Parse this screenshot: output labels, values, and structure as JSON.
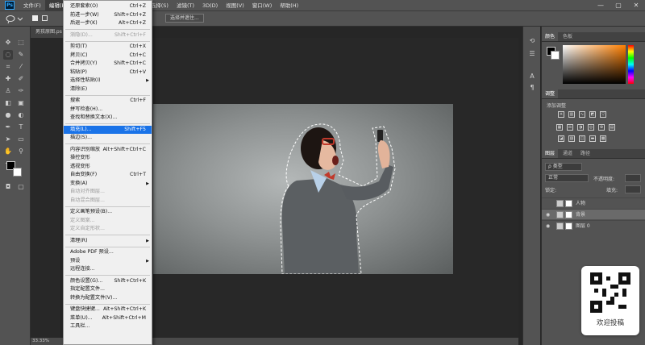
{
  "menubar": {
    "logo": "Ps",
    "items": [
      "文件(F)",
      "编辑(E)",
      "图像(I)",
      "图层(L)",
      "文字(Y)",
      "选择(S)",
      "滤镜(T)",
      "3D(D)",
      "视图(V)",
      "窗口(W)",
      "帮助(H)"
    ],
    "active_index": 1,
    "window_controls": [
      "—",
      "▢",
      "✕"
    ]
  },
  "optionsbar": {
    "select_mask_label": "选择并遮住..."
  },
  "document": {
    "tab_label": "男孩原图.ps",
    "zoom": "33.33%"
  },
  "edit_menu": {
    "items": [
      {
        "label": "还原套索(O)",
        "shortcut": "Ctrl+Z",
        "disabled": false,
        "arrow": false,
        "sep_after": false
      },
      {
        "label": "前进一步(W)",
        "shortcut": "Shift+Ctrl+Z",
        "disabled": false,
        "arrow": false,
        "sep_after": false
      },
      {
        "label": "后退一步(K)",
        "shortcut": "Alt+Ctrl+Z",
        "disabled": false,
        "arrow": false,
        "sep_after": true
      },
      {
        "label": "渐隐(D)...",
        "shortcut": "Shift+Ctrl+F",
        "disabled": true,
        "arrow": false,
        "sep_after": true
      },
      {
        "label": "剪切(T)",
        "shortcut": "Ctrl+X",
        "disabled": false,
        "arrow": false,
        "sep_after": false
      },
      {
        "label": "拷贝(C)",
        "shortcut": "Ctrl+C",
        "disabled": false,
        "arrow": false,
        "sep_after": false
      },
      {
        "label": "合并拷贝(Y)",
        "shortcut": "Shift+Ctrl+C",
        "disabled": false,
        "arrow": false,
        "sep_after": false
      },
      {
        "label": "粘贴(P)",
        "shortcut": "Ctrl+V",
        "disabled": false,
        "arrow": false,
        "sep_after": false
      },
      {
        "label": "选择性粘贴(I)",
        "shortcut": "",
        "disabled": false,
        "arrow": true,
        "sep_after": false
      },
      {
        "label": "清除(E)",
        "shortcut": "",
        "disabled": false,
        "arrow": false,
        "sep_after": true
      },
      {
        "label": "搜索",
        "shortcut": "Ctrl+F",
        "disabled": false,
        "arrow": false,
        "sep_after": false
      },
      {
        "label": "拼写检查(H)...",
        "shortcut": "",
        "disabled": false,
        "arrow": false,
        "sep_after": false
      },
      {
        "label": "查找和替换文本(X)...",
        "shortcut": "",
        "disabled": false,
        "arrow": false,
        "sep_after": true
      },
      {
        "label": "填充(L)...",
        "shortcut": "Shift+F5",
        "disabled": false,
        "arrow": false,
        "sep_after": false,
        "highlight": true
      },
      {
        "label": "描边(S)...",
        "shortcut": "",
        "disabled": false,
        "arrow": false,
        "sep_after": true
      },
      {
        "label": "内容识别缩放",
        "shortcut": "Alt+Shift+Ctrl+C",
        "disabled": false,
        "arrow": false,
        "sep_after": false
      },
      {
        "label": "操控变形",
        "shortcut": "",
        "disabled": false,
        "arrow": false,
        "sep_after": false
      },
      {
        "label": "透视变形",
        "shortcut": "",
        "disabled": false,
        "arrow": false,
        "sep_after": false
      },
      {
        "label": "自由变换(F)",
        "shortcut": "Ctrl+T",
        "disabled": false,
        "arrow": false,
        "sep_after": false
      },
      {
        "label": "变换(A)",
        "shortcut": "",
        "disabled": false,
        "arrow": true,
        "sep_after": false
      },
      {
        "label": "自动对齐图层...",
        "shortcut": "",
        "disabled": true,
        "arrow": false,
        "sep_after": false
      },
      {
        "label": "自动混合图层...",
        "shortcut": "",
        "disabled": true,
        "arrow": false,
        "sep_after": true
      },
      {
        "label": "定义画笔预设(B)...",
        "shortcut": "",
        "disabled": false,
        "arrow": false,
        "sep_after": false
      },
      {
        "label": "定义图案...",
        "shortcut": "",
        "disabled": true,
        "arrow": false,
        "sep_after": false
      },
      {
        "label": "定义自定形状...",
        "shortcut": "",
        "disabled": true,
        "arrow": false,
        "sep_after": true
      },
      {
        "label": "清理(R)",
        "shortcut": "",
        "disabled": false,
        "arrow": true,
        "sep_after": true
      },
      {
        "label": "Adobe PDF 预设...",
        "shortcut": "",
        "disabled": false,
        "arrow": false,
        "sep_after": false
      },
      {
        "label": "预设",
        "shortcut": "",
        "disabled": false,
        "arrow": true,
        "sep_after": false
      },
      {
        "label": "远程连接...",
        "shortcut": "",
        "disabled": false,
        "arrow": false,
        "sep_after": true
      },
      {
        "label": "颜色设置(G)...",
        "shortcut": "Shift+Ctrl+K",
        "disabled": false,
        "arrow": false,
        "sep_after": false
      },
      {
        "label": "指定配置文件...",
        "shortcut": "",
        "disabled": false,
        "arrow": false,
        "sep_after": false
      },
      {
        "label": "转换为配置文件(V)...",
        "shortcut": "",
        "disabled": false,
        "arrow": false,
        "sep_after": true
      },
      {
        "label": "键盘快捷键...",
        "shortcut": "Alt+Shift+Ctrl+K",
        "disabled": false,
        "arrow": false,
        "sep_after": false
      },
      {
        "label": "菜单(U)...",
        "shortcut": "Alt+Shift+Ctrl+M",
        "disabled": false,
        "arrow": false,
        "sep_after": false
      },
      {
        "label": "工具栏...",
        "shortcut": "",
        "disabled": false,
        "arrow": false,
        "sep_after": false
      }
    ]
  },
  "color_panel": {
    "tabs": [
      "颜色",
      "色板"
    ],
    "active": 0
  },
  "adjust_panel": {
    "tab": "调整",
    "add_label": "添加调整"
  },
  "layers_panel": {
    "tabs": [
      "图层",
      "通道",
      "路径"
    ],
    "filter_label": "ρ 类型",
    "blend_mode": "正常",
    "opacity_label": "不透明度:",
    "lock_label": "锁定:",
    "fill_label": "填充:",
    "layers": [
      {
        "name": "人物",
        "visible": false,
        "selected": false
      },
      {
        "name": "背景",
        "visible": true,
        "selected": true
      },
      {
        "name": "图层 0",
        "visible": true,
        "selected": false
      }
    ]
  },
  "watermark": {
    "caption": "欢迎投稿"
  }
}
